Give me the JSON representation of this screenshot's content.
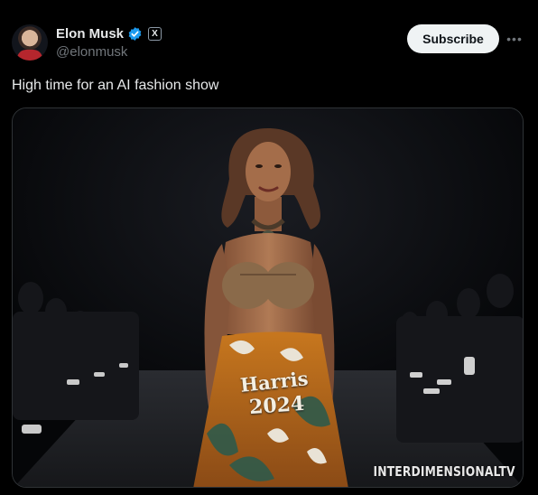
{
  "author": {
    "display_name": "Elon Musk",
    "handle": "@elonmusk",
    "verified_icon": "verified-badge-icon",
    "affiliate_badge": "X"
  },
  "actions": {
    "subscribe_label": "Subscribe",
    "more_icon": "more-options-icon",
    "more_glyph": "•••"
  },
  "post": {
    "text": "High time for an AI fashion show"
  },
  "media": {
    "skirt_line_1": "Harris",
    "skirt_line_2": "2024",
    "watermark": "INTERDIMENSIONALTV"
  },
  "colors": {
    "background": "#000000",
    "verified_blue": "#1d9bf0",
    "secondary_text": "#71767b",
    "subscribe_bg": "#eff3f4"
  }
}
